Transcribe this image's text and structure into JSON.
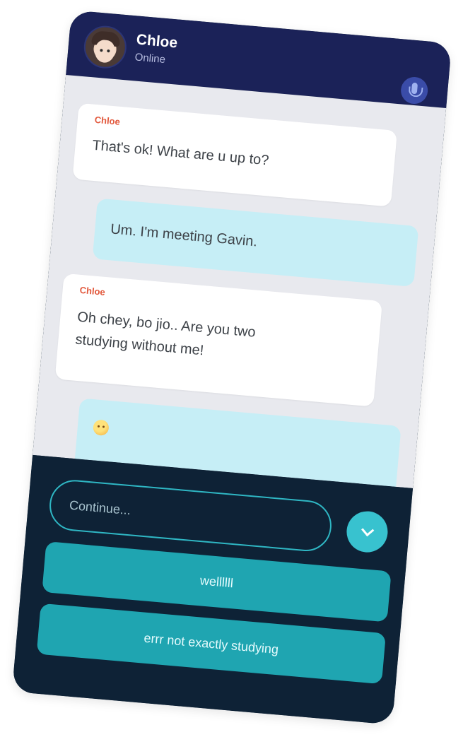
{
  "header": {
    "contact_name": "Chloe",
    "status": "Online",
    "avatar_icon": "user-avatar-icon",
    "mic_icon": "microphone-icon"
  },
  "messages": [
    {
      "direction": "incoming",
      "sender": "Chloe",
      "text": "That's ok! What are u up to?"
    },
    {
      "direction": "outgoing",
      "text": "Um. I'm meeting Gavin."
    },
    {
      "direction": "incoming",
      "sender": "Chloe",
      "text_lines": [
        "Oh chey, bo jio.. Are you two",
        "studying without me!"
      ]
    },
    {
      "direction": "outgoing",
      "emoji_icon": "smiling-face-icon"
    }
  ],
  "composer": {
    "placeholder": "Continue...",
    "expand_icon": "chevron-down-icon"
  },
  "reply_options": [
    {
      "label": "wellllll"
    },
    {
      "label": "errr not exactly studying"
    }
  ],
  "colors": {
    "header_bg": "#1b2258",
    "chat_bg": "#e8e9ee",
    "incoming_bubble": "#ffffff",
    "outgoing_bubble": "#c6eef6",
    "sender_name": "#e2583c",
    "controls_bg": "#0e2236",
    "accent": "#38c2cf",
    "reply_button": "#1fa5b1"
  }
}
